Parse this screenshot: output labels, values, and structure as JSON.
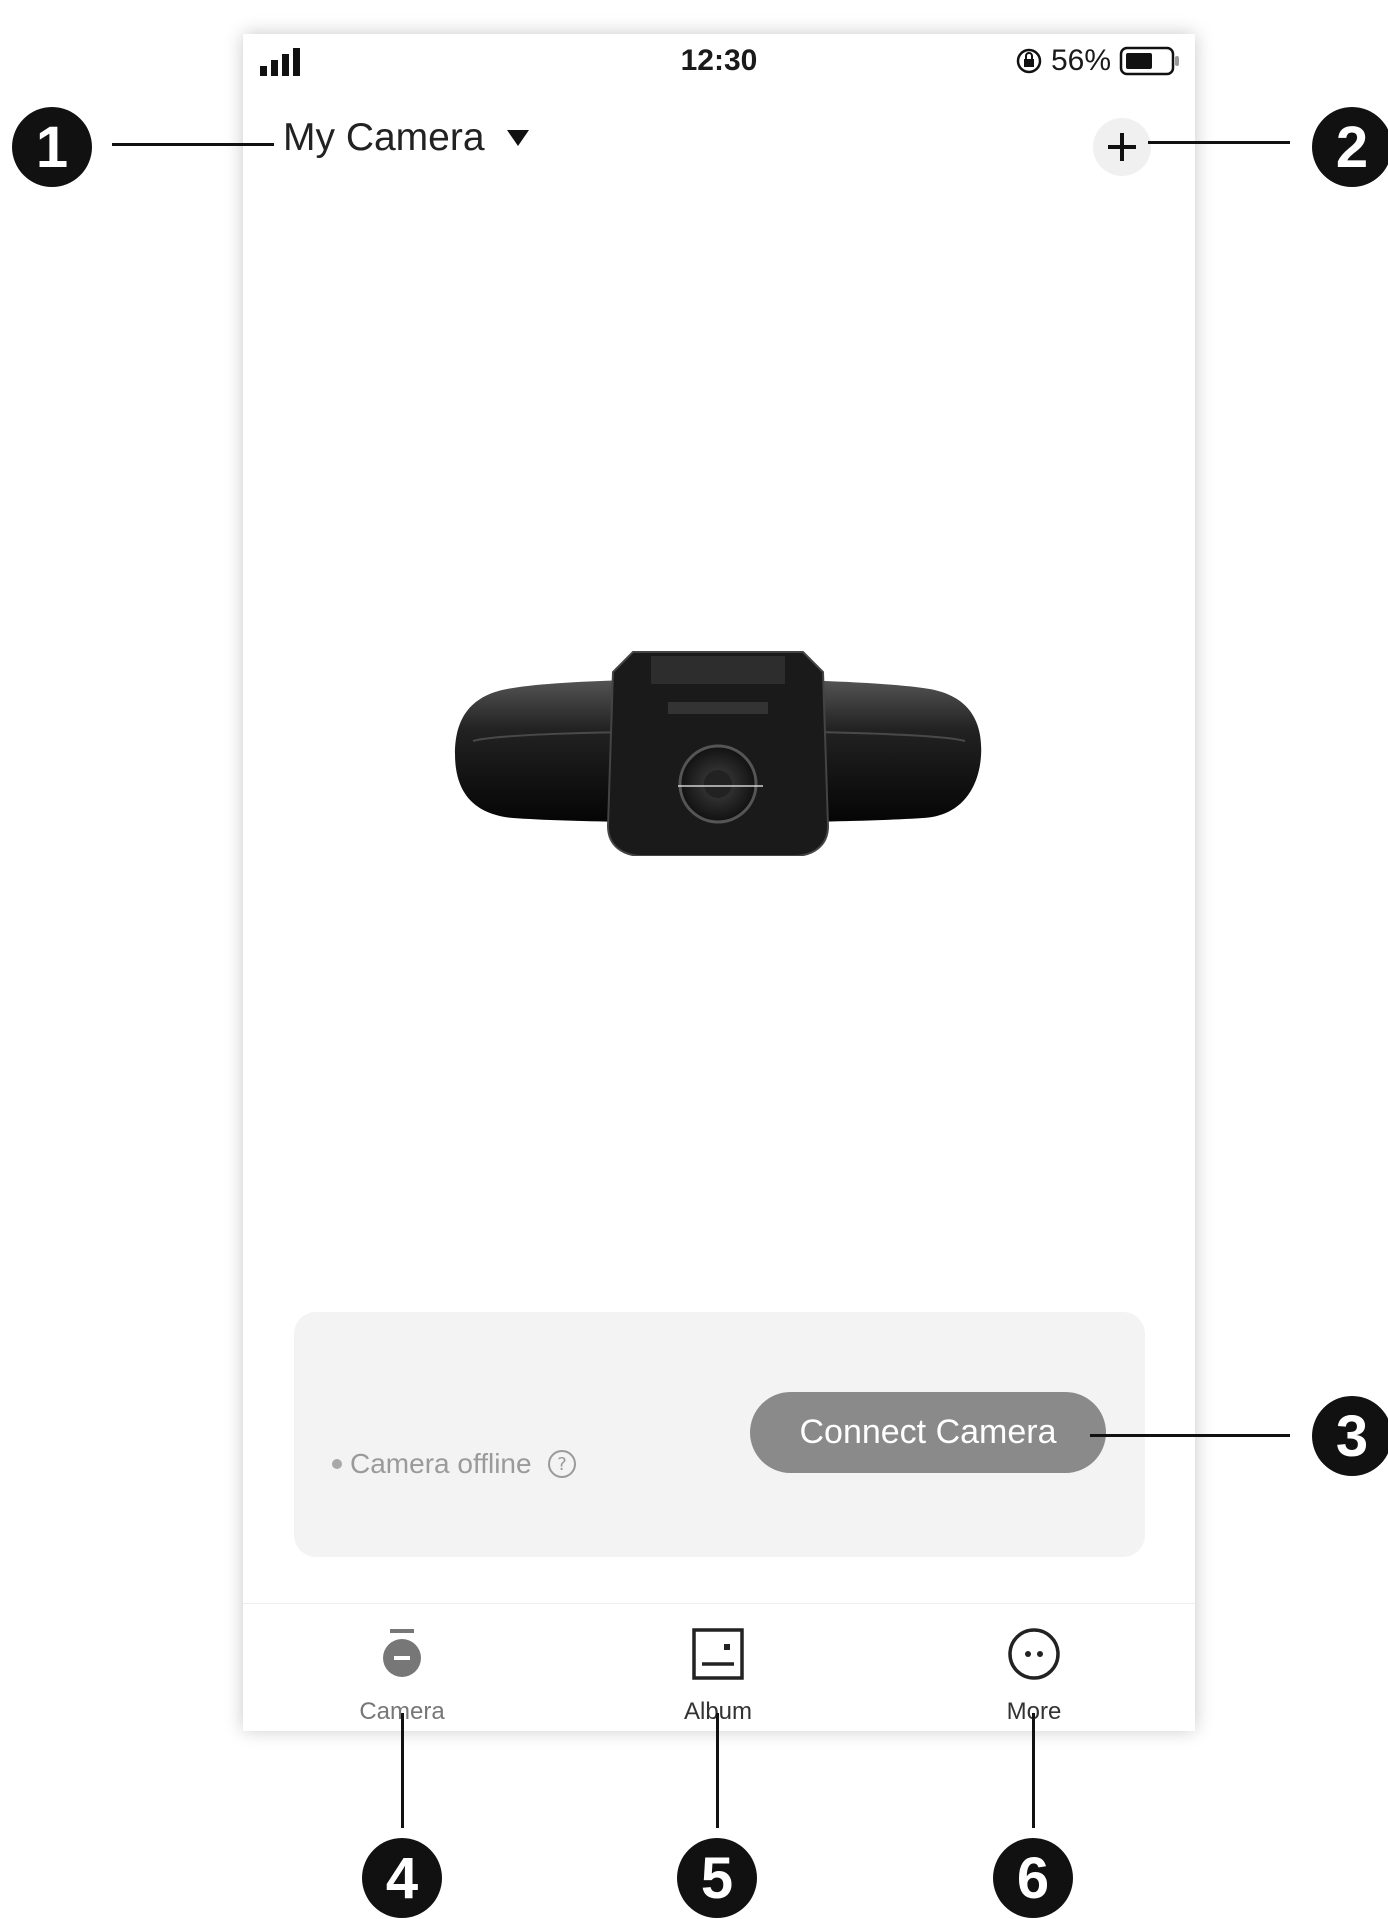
{
  "status_bar": {
    "time": "12:30",
    "battery_percent": "56%"
  },
  "header": {
    "title": "My Camera"
  },
  "card": {
    "status_text": "Camera offline",
    "connect_label": "Connect Camera"
  },
  "tabs": [
    {
      "label": "Camera",
      "icon": "camera-icon",
      "active": true
    },
    {
      "label": "Album",
      "icon": "album-icon"
    },
    {
      "label": "More",
      "icon": "more-icon"
    }
  ],
  "callouts": [
    "1",
    "2",
    "3",
    "4",
    "5",
    "6"
  ],
  "colors": {
    "button": "#8a8a8a",
    "card": "#f3f3f3"
  }
}
